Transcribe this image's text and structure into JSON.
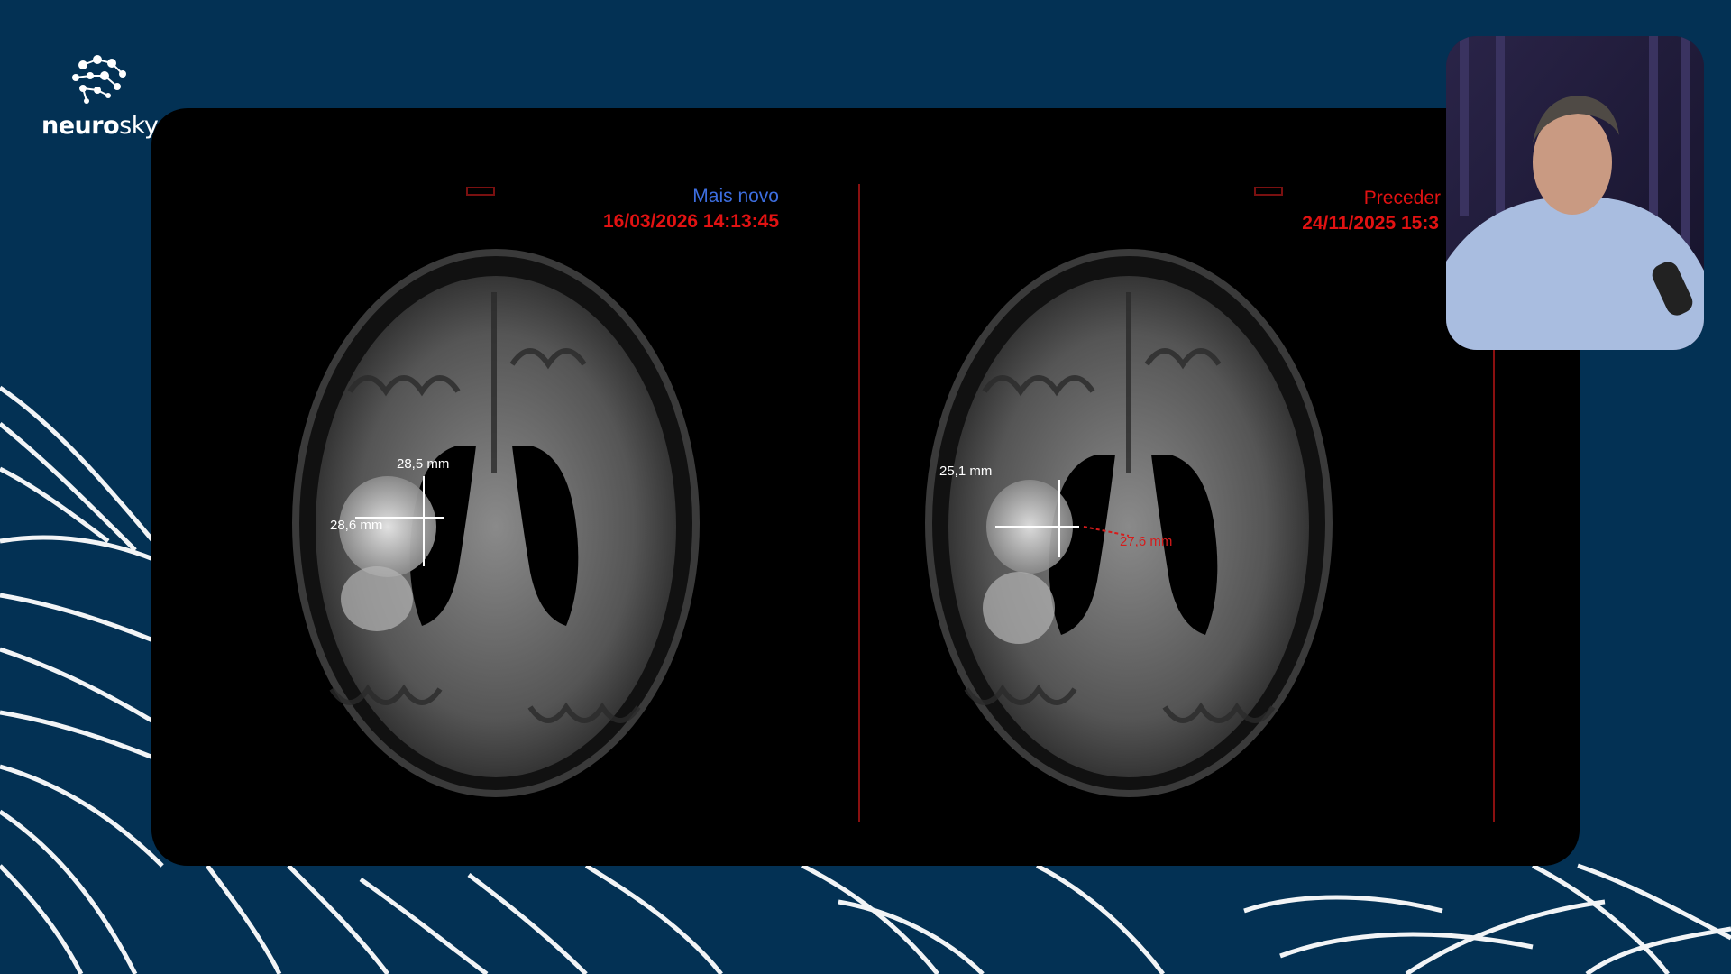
{
  "brand": {
    "name_bold": "neuro",
    "name_light": "sky"
  },
  "viewer": {
    "left_panel": {
      "series_label": "Mais novo",
      "date": "16/03/2026 14:13:45",
      "measure_1": "28,5 mm",
      "measure_2": "28,6 mm"
    },
    "right_panel": {
      "series_label": "Preceder",
      "date": "24/11/2025 15:3",
      "measure_1": "25,1 mm",
      "measure_2": "27,6 mm"
    }
  },
  "colors": {
    "background": "#033154",
    "viewer": "#000000",
    "series_new": "#3d6ee0",
    "date_red": "#e11212",
    "waves": "#ffffff"
  },
  "icons": [
    "neurosky-logo-icon"
  ]
}
